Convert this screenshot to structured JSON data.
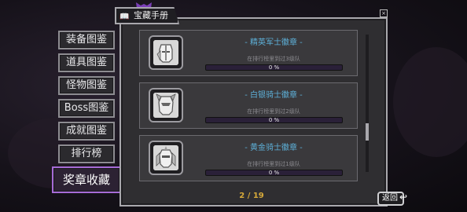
{
  "panel": {
    "title": "宝藏手册",
    "page_indicator": "2 / 19",
    "back_label": "返回"
  },
  "tabs": [
    {
      "label": "装备图鉴"
    },
    {
      "label": "道具图鉴"
    },
    {
      "label": "怪物图鉴"
    },
    {
      "label": "Boss图鉴"
    },
    {
      "label": "成就图鉴"
    },
    {
      "label": "排行榜"
    },
    {
      "label": "奖章收藏",
      "active": true
    }
  ],
  "medals": [
    {
      "title": "- 精英军士徽章 -",
      "desc": "在排行榜里到过3级队",
      "progress_label": "0 %",
      "progress": 0
    },
    {
      "title": "- 白银骑士徽章 -",
      "desc": "在排行榜里到过2级队",
      "progress_label": "0 %",
      "progress": 0
    },
    {
      "title": "- 黄金骑士徽章 -",
      "desc": "在排行榜里到过1级队",
      "progress_label": "0 %",
      "progress": 0
    }
  ],
  "scroll": {
    "position_fraction": 0.65
  }
}
